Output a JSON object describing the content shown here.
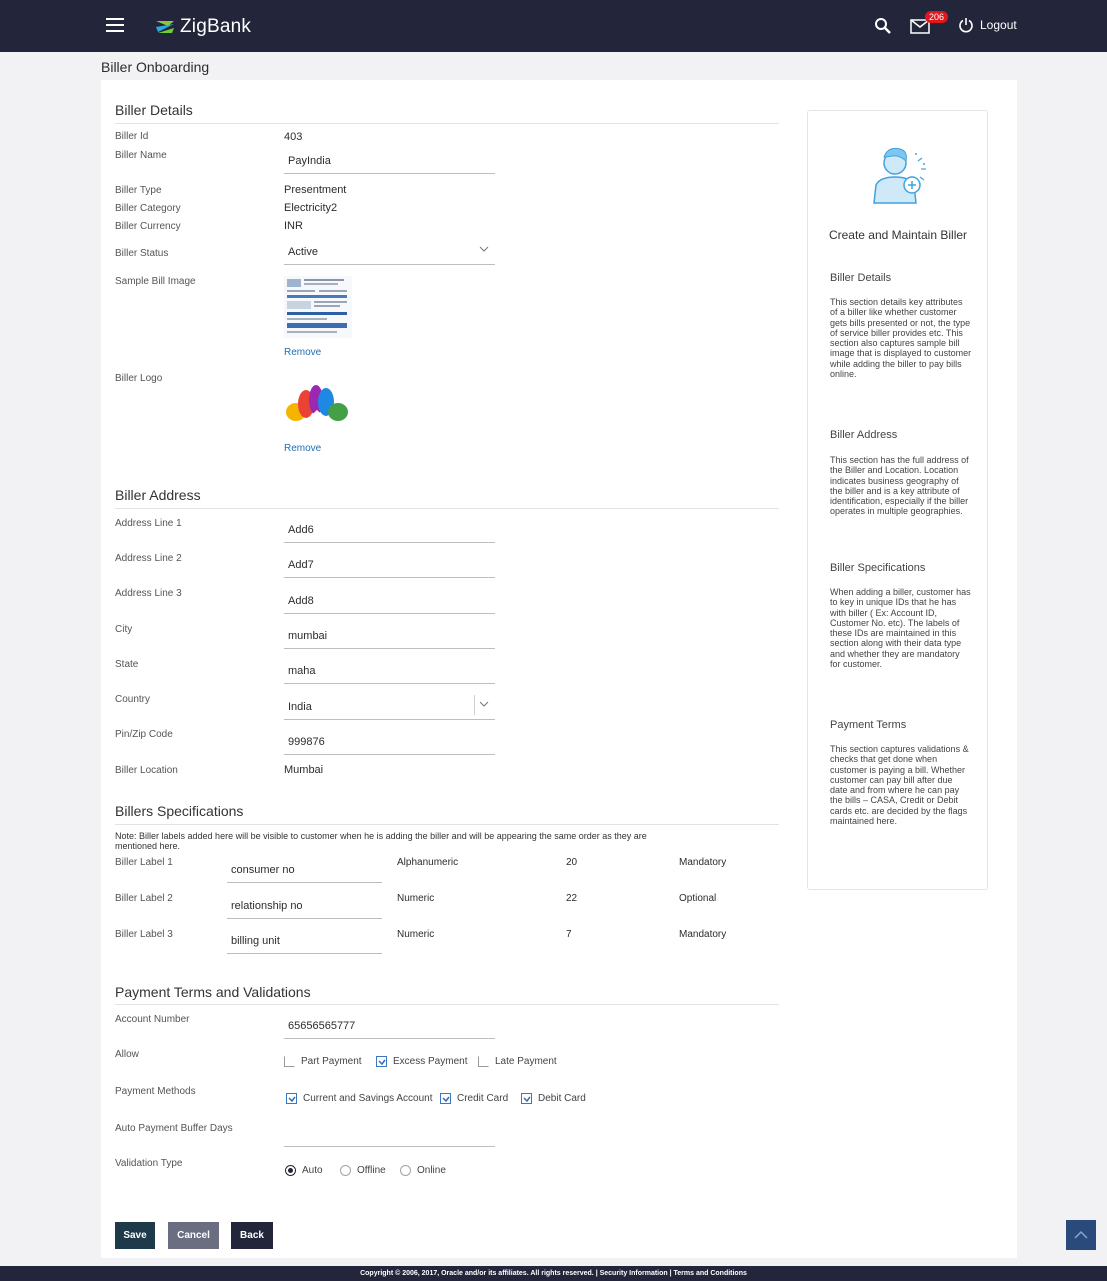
{
  "header": {
    "app_name": "ZigBank",
    "mail_count": "206",
    "logout_label": "Logout"
  },
  "page_title": "Biller Onboarding",
  "biller_details": {
    "title": "Biller Details",
    "biller_id_label": "Biller Id",
    "biller_id": "403",
    "biller_name_label": "Biller Name",
    "biller_name": "PayIndia",
    "biller_type_label": "Biller Type",
    "biller_type": "Presentment",
    "biller_category_label": "Biller Category",
    "biller_category": "Electricity2",
    "biller_currency_label": "Biller Currency",
    "biller_currency": "INR",
    "biller_status_label": "Biller Status",
    "biller_status": "Active",
    "sample_bill_label": "Sample Bill Image",
    "remove_label_1": "Remove",
    "biller_logo_label": "Biller Logo",
    "remove_label_2": "Remove"
  },
  "biller_address": {
    "title": "Biller Address",
    "fields": [
      {
        "label": "Address Line 1",
        "value": "Add6"
      },
      {
        "label": "Address Line 2",
        "value": "Add7"
      },
      {
        "label": "Address Line 3",
        "value": "Add8"
      },
      {
        "label": "City",
        "value": "mumbai"
      },
      {
        "label": "State",
        "value": "maha"
      },
      {
        "label": "Country",
        "value": "India"
      },
      {
        "label": "Pin/Zip Code",
        "value": "999876"
      }
    ],
    "location_label": "Biller Location",
    "location": "Mumbai"
  },
  "specifications": {
    "title": "Billers Specifications",
    "note": "Note: Biller labels added here will be visible to customer when he is adding the biller and will be appearing the same order as they are mentioned here.",
    "rows": [
      {
        "label": "Biller Label 1",
        "value": "consumer no",
        "type": "Alphanumeric",
        "length": "20",
        "requirement": "Mandatory"
      },
      {
        "label": "Biller Label 2",
        "value": "relationship no",
        "type": "Numeric",
        "length": "22",
        "requirement": "Optional"
      },
      {
        "label": "Biller Label 3",
        "value": "billing unit",
        "type": "Numeric",
        "length": "7",
        "requirement": "Mandatory"
      }
    ]
  },
  "payment_terms": {
    "title": "Payment Terms and Validations",
    "account_label": "Account Number",
    "account_number": "65656565777",
    "allow_label": "Allow",
    "allow_options": [
      {
        "label": "Part Payment",
        "checked": false
      },
      {
        "label": "Excess Payment",
        "checked": true
      },
      {
        "label": "Late Payment",
        "checked": false
      }
    ],
    "methods_label": "Payment Methods",
    "methods": [
      {
        "label": "Current and Savings Account",
        "checked": true
      },
      {
        "label": "Credit Card",
        "checked": true
      },
      {
        "label": "Debit Card",
        "checked": true
      }
    ],
    "buffer_label": "Auto Payment Buffer Days",
    "buffer_value": "",
    "validation_label": "Validation Type",
    "validation_options": [
      {
        "label": "Auto",
        "selected": true
      },
      {
        "label": "Offline",
        "selected": false
      },
      {
        "label": "Online",
        "selected": false
      }
    ]
  },
  "actions": {
    "save": "Save",
    "cancel": "Cancel",
    "back": "Back"
  },
  "help": {
    "title": "Create and Maintain Biller",
    "sections": [
      {
        "heading": "Biller Details",
        "text": "This section details key attributes of a biller like whether customer gets bills presented or not, the type of service biller provides etc. This section also captures sample bill image that is displayed to customer while adding the biller to pay bills online."
      },
      {
        "heading": "Biller Address",
        "text": "This section has the full address of the Biller and Location. Location indicates business geography of the biller and is a key attribute of identification, especially if the biller operates in multiple geographies."
      },
      {
        "heading": "Biller Specifications",
        "text": "When adding a biller, customer has to key in unique IDs that he has with biller ( Ex: Account ID, Customer No. etc). The labels of these IDs are maintained in this section along with their data type and whether they are mandatory for customer."
      },
      {
        "heading": "Payment Terms",
        "text": "This section captures validations & checks that get done when customer is paying a bill. Whether customer can pay bill after due date and from where he can pay the bills – CASA, Credit or Debit cards etc. are decided by the flags maintained here."
      }
    ]
  },
  "footer": {
    "text": "Copyright © 2006, 2017, Oracle and/or its affiliates. All rights reserved. | Security Information | Terms and Conditions"
  },
  "colors": {
    "header_bg": "#23263b",
    "link": "#1c6fb7",
    "save_button": "#1e3a4a",
    "cancel_button": "#6b6e80",
    "back_button": "#23263b"
  }
}
